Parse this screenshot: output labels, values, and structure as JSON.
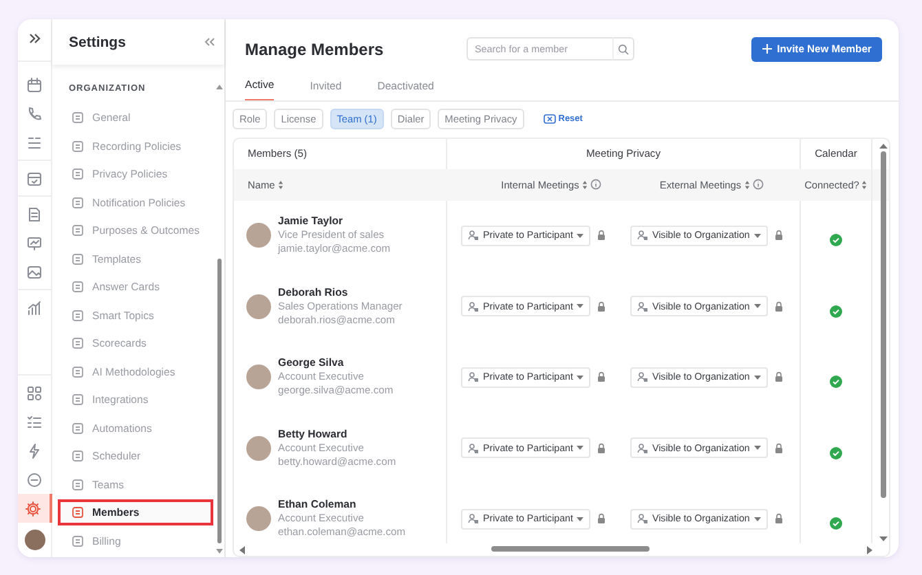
{
  "rail": {
    "items": [
      {
        "selected": false
      },
      {
        "selected": false
      },
      {
        "selected": false
      },
      {
        "selected": false
      },
      {
        "selected": false
      },
      {
        "selected": false
      },
      {
        "selected": false
      },
      {
        "selected": false
      },
      {
        "selected": false
      },
      {
        "selected": false
      },
      {
        "selected": false
      },
      {
        "selected": false
      },
      {
        "selected": true
      }
    ]
  },
  "sidebar": {
    "title": "Settings",
    "section": "ORGANIZATION",
    "items": [
      {
        "label": "General",
        "selected": false
      },
      {
        "label": "Recording Policies",
        "selected": false
      },
      {
        "label": "Privacy Policies",
        "selected": false
      },
      {
        "label": "Notification Policies",
        "selected": false
      },
      {
        "label": "Purposes & Outcomes",
        "selected": false
      },
      {
        "label": "Templates",
        "selected": false
      },
      {
        "label": "Answer Cards",
        "selected": false
      },
      {
        "label": "Smart Topics",
        "selected": false
      },
      {
        "label": "Scorecards",
        "selected": false
      },
      {
        "label": "AI Methodologies",
        "selected": false
      },
      {
        "label": "Integrations",
        "selected": false
      },
      {
        "label": "Automations",
        "selected": false
      },
      {
        "label": "Scheduler",
        "selected": false
      },
      {
        "label": "Teams",
        "selected": false
      },
      {
        "label": "Members",
        "selected": true
      },
      {
        "label": "Billing",
        "selected": false
      }
    ]
  },
  "main": {
    "title": "Manage Members",
    "search": {
      "placeholder": "Search for a member"
    },
    "invite_button": "Invite New Member",
    "tabs": [
      {
        "label": "Active",
        "selected": true
      },
      {
        "label": "Invited",
        "selected": false
      },
      {
        "label": "Deactivated",
        "selected": false
      }
    ],
    "filters": [
      {
        "label": "Role",
        "selected": false
      },
      {
        "label": "License",
        "selected": false
      },
      {
        "label": "Team (1)",
        "selected": true
      },
      {
        "label": "Dialer",
        "selected": false
      },
      {
        "label": "Meeting Privacy",
        "selected": false
      }
    ],
    "reset": "Reset",
    "table": {
      "groups": [
        "Members (5)",
        "Meeting Privacy",
        "Calendar"
      ],
      "columns": [
        "Name",
        "Internal Meetings",
        "External Meetings",
        "Connected?"
      ],
      "rows": [
        {
          "name": "Jamie Taylor",
          "title": "Vice President of sales",
          "email": "jamie.taylor@acme.com",
          "internal": "Private to Participant",
          "external": "Visible to Organization",
          "connected": true
        },
        {
          "name": "Deborah Rios",
          "title": "Sales Operations Manager",
          "email": "deborah.rios@acme.com",
          "internal": "Private to Participant",
          "external": "Visible to Organization",
          "connected": true
        },
        {
          "name": "George Silva",
          "title": "Account Executive",
          "email": "george.silva@acme.com",
          "internal": "Private to Participant",
          "external": "Visible to Organization",
          "connected": true
        },
        {
          "name": "Betty Howard",
          "title": "Account Executive",
          "email": "betty.howard@acme.com",
          "internal": "Private to Participant",
          "external": "Visible to Organization",
          "connected": true
        },
        {
          "name": "Ethan Coleman",
          "title": "Account Executive",
          "email": "ethan.coleman@acme.com",
          "internal": "Private to Participant",
          "external": "Visible to Organization",
          "connected": true
        }
      ]
    }
  }
}
